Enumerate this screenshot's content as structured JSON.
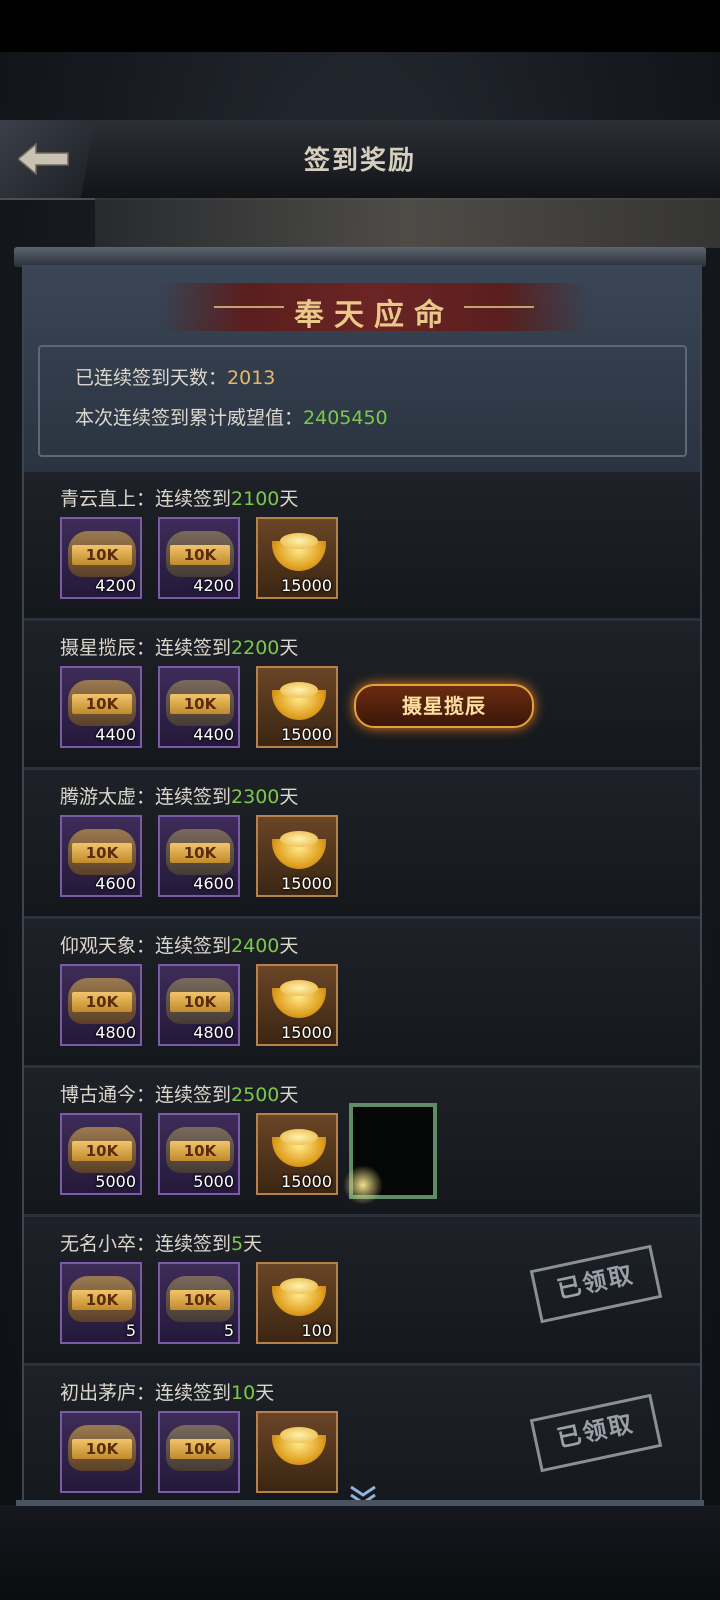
{
  "header": {
    "title": "签到奖励",
    "back_icon": "back-arrow-icon"
  },
  "banner": {
    "text": "奉天应命"
  },
  "summary": {
    "days_label": "已连续签到天数：",
    "days_value": "2013",
    "prestige_label": "本次连续签到累计威望值：",
    "prestige_value": "2405450"
  },
  "item_tag": "10K",
  "rows": [
    {
      "name": "青云直上",
      "label": "：连续签到",
      "days": "2100",
      "unit": "天",
      "q1": "4200",
      "q2": "4200",
      "q3": "15000",
      "status": ""
    },
    {
      "name": "摄星揽辰",
      "label": "：连续签到",
      "days": "2200",
      "unit": "天",
      "q1": "4400",
      "q2": "4400",
      "q3": "15000",
      "status": "",
      "badge": "摄星揽辰"
    },
    {
      "name": "腾游太虚",
      "label": "：连续签到",
      "days": "2300",
      "unit": "天",
      "q1": "4600",
      "q2": "4600",
      "q3": "15000",
      "status": ""
    },
    {
      "name": "仰观天象",
      "label": "：连续签到",
      "days": "2400",
      "unit": "天",
      "q1": "4800",
      "q2": "4800",
      "q3": "15000",
      "status": ""
    },
    {
      "name": "博古通今",
      "label": "：连续签到",
      "days": "2500",
      "unit": "天",
      "q1": "5000",
      "q2": "5000",
      "q3": "15000",
      "status": ""
    },
    {
      "name": "无名小卒",
      "label": "：连续签到",
      "days": "5",
      "unit": "天",
      "q1": "5",
      "q2": "5",
      "q3": "100",
      "status": "已领取"
    },
    {
      "name": "初出茅庐",
      "label": "：连续签到",
      "days": "10",
      "unit": "天",
      "q1": "",
      "q2": "",
      "q3": "",
      "status": "已领取"
    }
  ],
  "colors": {
    "gold": "#e6b86a",
    "green": "#7cc94a",
    "purple_frame": "#7b5aa8",
    "gold_frame": "#b8804a"
  }
}
